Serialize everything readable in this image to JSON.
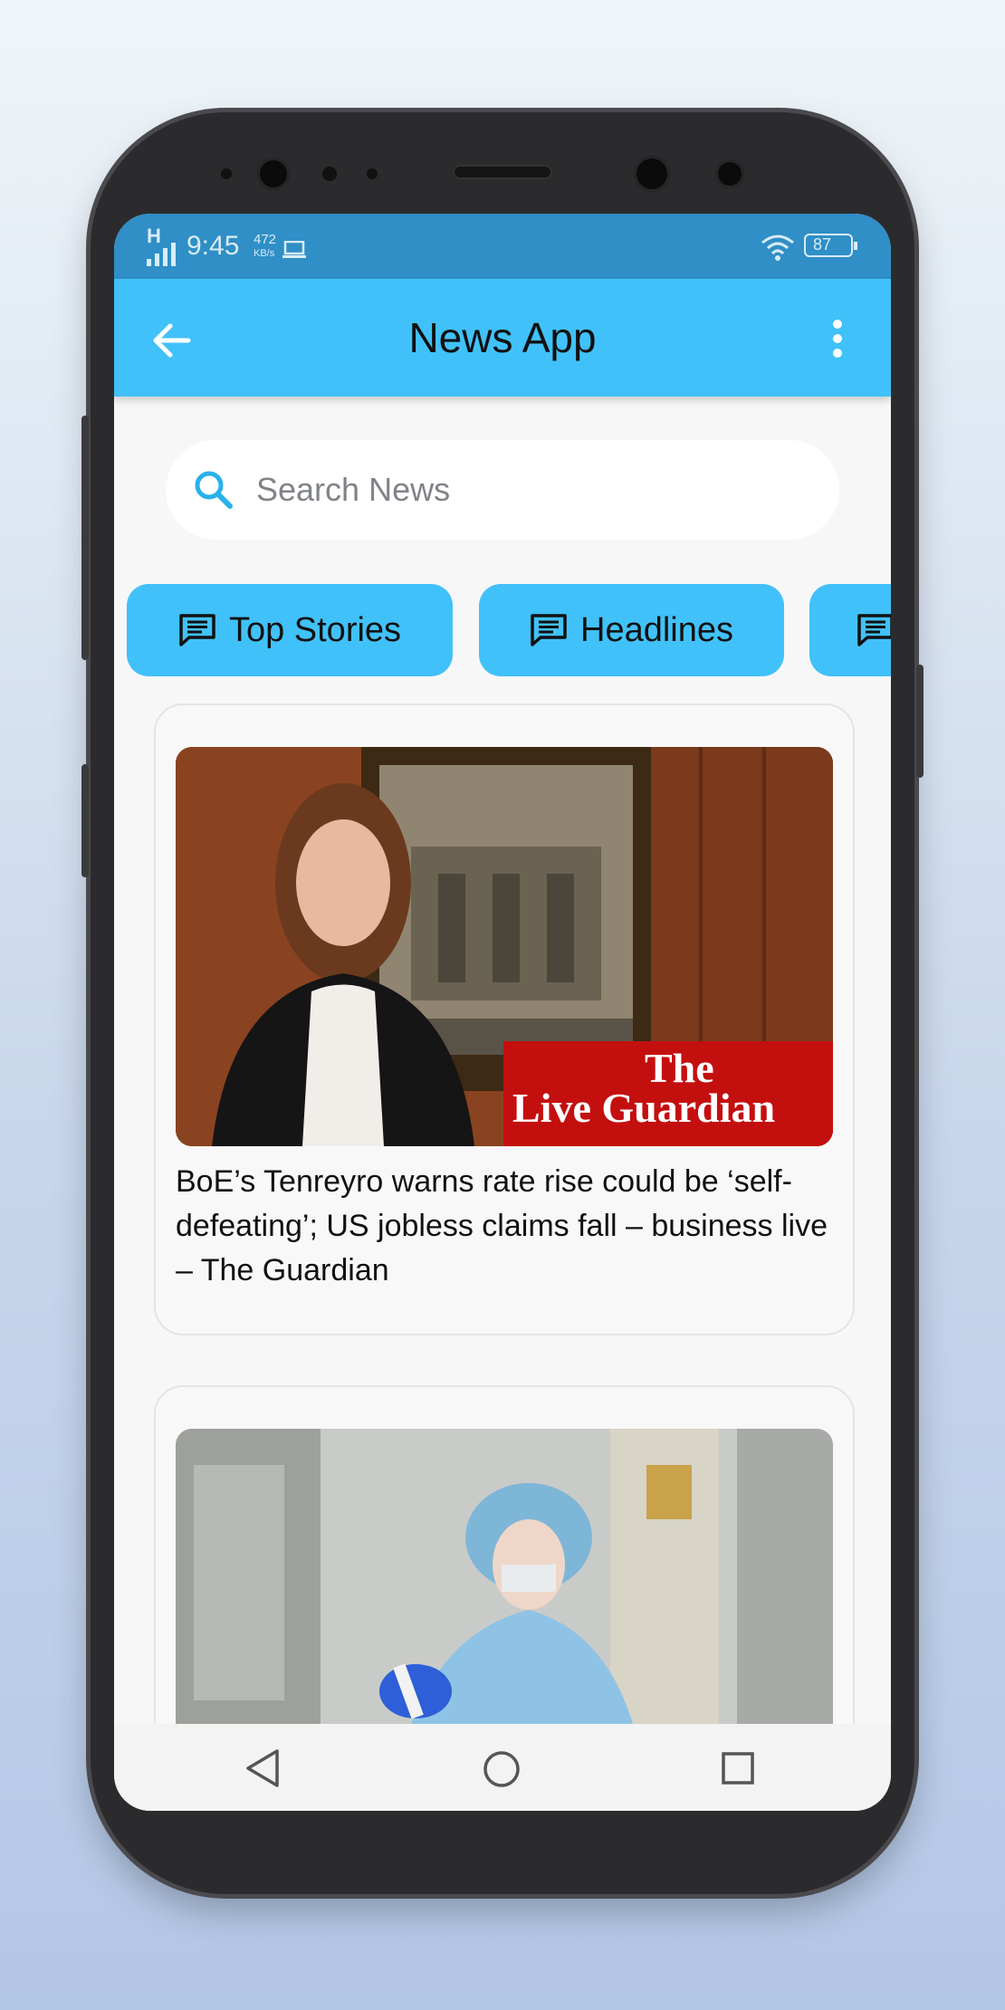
{
  "status_bar": {
    "network": "H",
    "time": "9:45",
    "speed_value": "472",
    "speed_unit": "KB/s",
    "battery": "87"
  },
  "app_bar": {
    "title": "News App"
  },
  "search": {
    "placeholder": "Search News"
  },
  "categories": [
    {
      "label": "Top Stories",
      "icon": "news-icon"
    },
    {
      "label": "Headlines",
      "icon": "news-icon"
    },
    {
      "label": "",
      "icon": "news-icon"
    }
  ],
  "articles": [
    {
      "headline": "BoE’s Tenreyro warns rate rise could be ‘self-defeating’; US jobless claims fall – business live – The Guardian",
      "image_logo_line1": "The",
      "image_logo_line2": "Live Guardian"
    },
    {
      "headline": ""
    }
  ],
  "colors": {
    "app_bar": "#41c1f9",
    "status_bar": "#2f8fc6",
    "chip": "#41c1f9",
    "guardian_red": "#c70000"
  },
  "nav": {
    "back": "back-triangle-icon",
    "home": "home-circle-icon",
    "recents": "recents-square-icon"
  }
}
